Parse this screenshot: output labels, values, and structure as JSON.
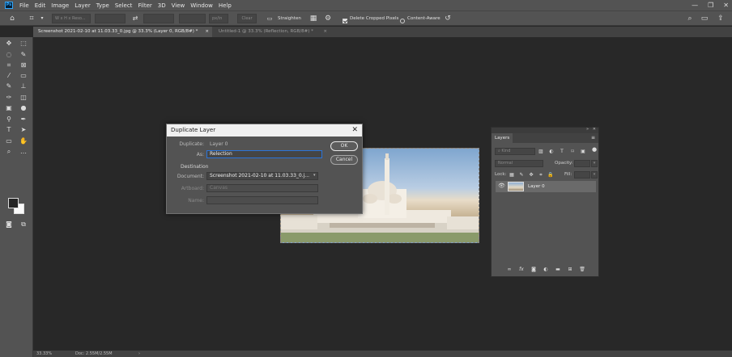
{
  "menu": {
    "items": [
      "File",
      "Edit",
      "Image",
      "Layer",
      "Type",
      "Select",
      "Filter",
      "3D",
      "View",
      "Window",
      "Help"
    ]
  },
  "options": {
    "ratio_placeholder": "W x H x Reso...",
    "units": "px/in",
    "clear": "Clear",
    "straighten": "Straighten",
    "delete_cropped": "Delete Cropped Pixels",
    "content_aware": "Content-Aware"
  },
  "tabs": [
    {
      "label": "Screenshot 2021-02-10 at 11.03.33_0.jpg @ 33.3% (Layer 0, RGB/8#) *"
    },
    {
      "label": "Untitled-1 @ 33.3% (Reflection, RGB/8#) *"
    }
  ],
  "dialog": {
    "title": "Duplicate Layer",
    "duplicate_label": "Duplicate:",
    "duplicate_value": "Layer 0",
    "as_label": "As:",
    "as_value": "Relection",
    "destination_heading": "Destination",
    "document_label": "Document:",
    "document_value": "Screenshot 2021-02-10 at 11.03.33_0.j...",
    "artboard_label": "Artboard:",
    "artboard_value": "Canvas",
    "name_label": "Name:",
    "ok": "OK",
    "cancel": "Cancel"
  },
  "layers": {
    "tab": "Layers",
    "kind": "Kind",
    "blend_mode": "Normal",
    "opacity_label": "Opacity:",
    "lock_label": "Lock:",
    "fill_label": "Fill:",
    "layer_name": "Layer 0"
  },
  "status": {
    "zoom": "33.33%",
    "doc": "Doc: 2.55M/2.55M"
  }
}
